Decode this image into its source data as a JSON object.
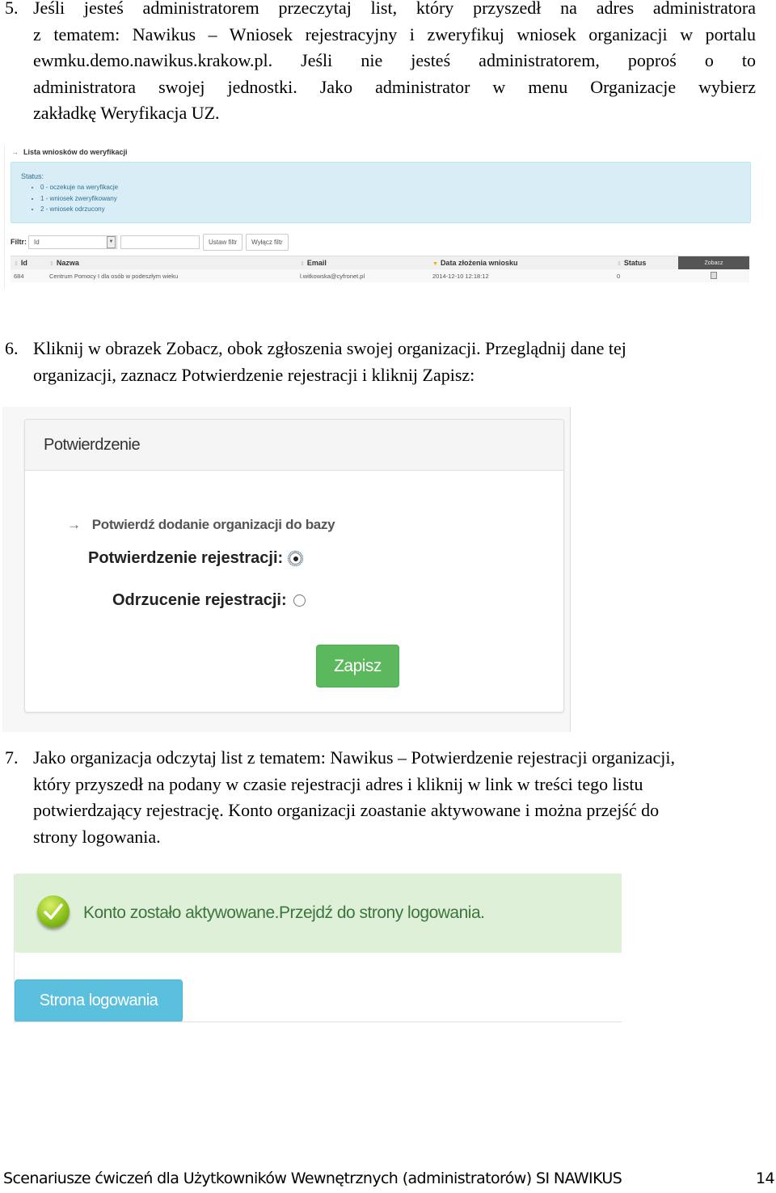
{
  "step5": {
    "number": "5.",
    "lines": [
      "Jeśli jesteś administratorem przeczytaj list, który przyszedł na adres administratora",
      "z tematem: Nawikus – Wniosek rejestracyjny i zweryfikuj wniosek organizacji w portalu",
      "ewmku.demo.nawikus.krakow.pl. Jeśli nie jesteś administratorem, poproś o to",
      "administratora swojej jednostki. Jako administrator w menu Organizacje wybierz",
      "zakładkę Weryfikacja UZ."
    ]
  },
  "verification_list": {
    "title": "Lista wniosków do weryfikacji",
    "status_label": "Status:",
    "statuses": [
      "0 - oczekuje na weryfikacje",
      "1 - wniosek zweryfikowany",
      "2 - wniosek odrzucony"
    ],
    "filter": {
      "label": "Filtr:",
      "select_value": "Id",
      "input_value": "",
      "set_button": "Ustaw filtr",
      "clear_button": "Wyłącz filtr"
    },
    "columns": [
      "Id",
      "Nazwa",
      "Email",
      "Data złożenia wniosku",
      "Status",
      "Zobacz"
    ],
    "rows": [
      {
        "id": "684",
        "name": "Centrum Pomocy I dla osób w podeszłym wieku",
        "email": "l.witkowska@cyfronet.pl",
        "date": "2014-12-10 12:18:12",
        "status": "0",
        "action_icon": "document-icon"
      }
    ]
  },
  "step6": {
    "number": "6.",
    "lines": [
      "Kliknij w obrazek Zobacz, obok zgłoszenia swojej organizacji. Przeglądnij dane tej",
      "organizacji, zaznacz Potwierdzenie rejestracji i kliknij Zapisz:"
    ]
  },
  "confirmation_panel": {
    "heading": "Potwierdzenie",
    "subtitle": "Potwierdź dodanie organizacji do bazy",
    "options": [
      {
        "label": "Potwierdzenie rejestracji:",
        "checked": true
      },
      {
        "label": "Odrzucenie rejestracji:",
        "checked": false
      }
    ],
    "save_button": "Zapisz"
  },
  "step7": {
    "number": "7.",
    "lines": [
      "Jako organizacja odczytaj list z tematem: Nawikus – Potwierdzenie rejestracji organizacji,",
      "który przyszedł na podany w czasie rejestracji adres i kliknij w link w treści tego listu",
      "potwierdzający rejestrację. Konto organizacji zoastanie aktywowane i można przejść do",
      "strony logowania."
    ]
  },
  "activation": {
    "message": "Konto zostało aktywowane.Przejdź do strony logowania.",
    "icon": "checkmark-icon",
    "login_button": "Strona logowania"
  },
  "footer": {
    "title": "Scenariusze ćwiczeń dla Użytkowników Wewnętrznych (administratorów) SI NAWIKUS",
    "page": "14"
  },
  "colors": {
    "info_bg": "#d9edf7",
    "success_bg": "#dff0d8",
    "save_green": "#5cb85c",
    "login_blue": "#5bc0de"
  }
}
